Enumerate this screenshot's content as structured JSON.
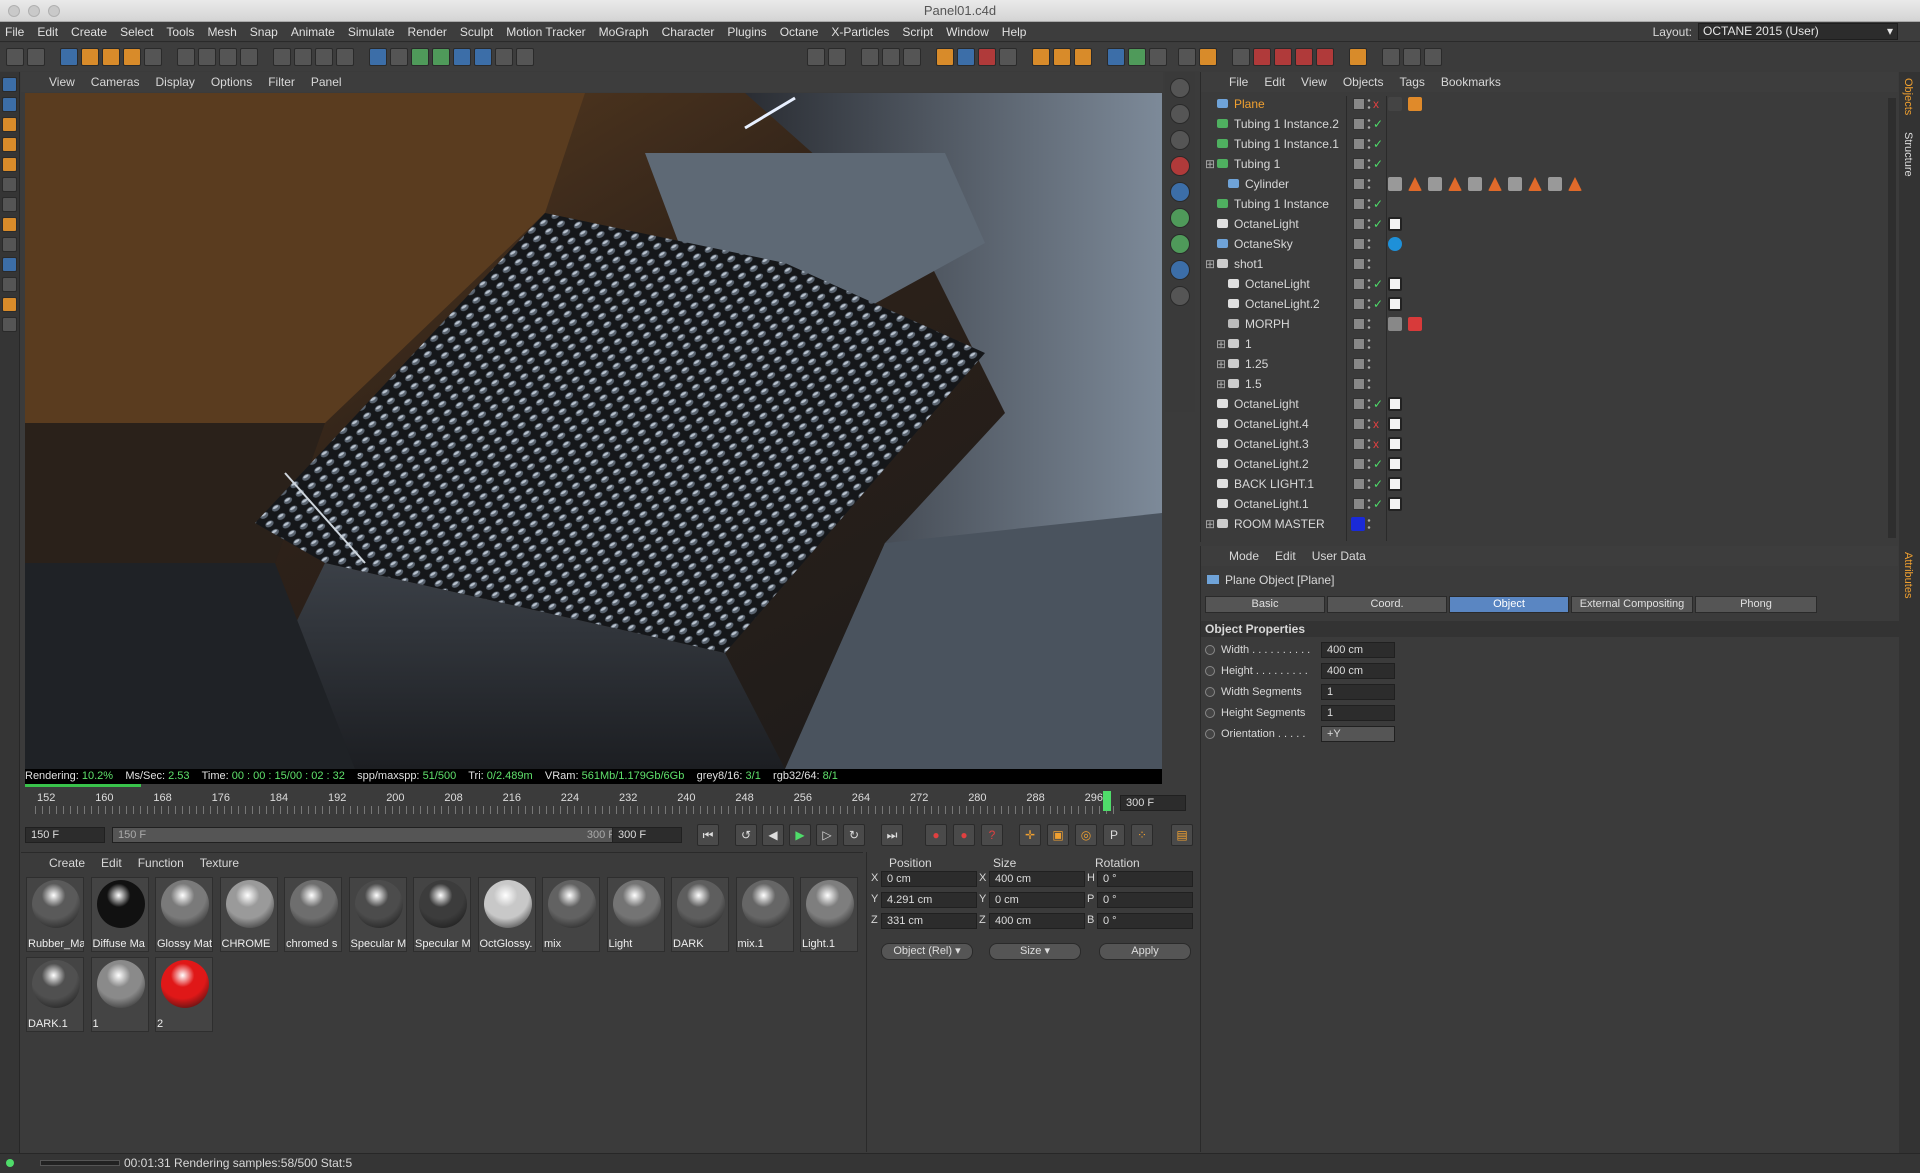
{
  "window": {
    "title": "Panel01.c4d"
  },
  "menu": [
    "File",
    "Edit",
    "Create",
    "Select",
    "Tools",
    "Mesh",
    "Snap",
    "Animate",
    "Simulate",
    "Render",
    "Sculpt",
    "Motion Tracker",
    "MoGraph",
    "Character",
    "Plugins",
    "Octane",
    "X-Particles",
    "Script",
    "Window",
    "Help"
  ],
  "layout": {
    "label": "Layout:",
    "value": "OCTANE 2015 (User)"
  },
  "viewport": {
    "menu": [
      "View",
      "Cameras",
      "Display",
      "Options",
      "Filter",
      "Panel"
    ]
  },
  "render_status": {
    "rendering_label": "Rendering:",
    "rendering": "10.2%",
    "ms_label": "Ms/Sec:",
    "ms": "2.53",
    "time_label": "Time:",
    "time": "00 : 00 : 15/00 : 02 : 32",
    "spp_label": "spp/maxspp:",
    "spp": "51/500",
    "tri_label": "Tri:",
    "tri": "0/2.489m",
    "vram_label": "VRam:",
    "vram": "561Mb/1.179Gb/6Gb",
    "grey_label": "grey8/16:",
    "grey": "3/1",
    "rgb_label": "rgb32/64:",
    "rgb": "8/1",
    "progress": 0.102
  },
  "timeline": {
    "ticks": [
      "152",
      "160",
      "168",
      "176",
      "184",
      "192",
      "200",
      "208",
      "216",
      "224",
      "232",
      "240",
      "248",
      "256",
      "264",
      "272",
      "280",
      "288",
      "296"
    ],
    "end_field": "300 F",
    "current": "150 F",
    "range_start": "150 F",
    "range_end": "300 F",
    "max": "300 F"
  },
  "materials": {
    "menu": [
      "Create",
      "Edit",
      "Function",
      "Texture"
    ],
    "items": [
      {
        "label": "Rubber_Ma",
        "color": "#5a5a5a"
      },
      {
        "label": "Diffuse Ma",
        "color": "#111111"
      },
      {
        "label": "Glossy Mat",
        "color": "#7a7a7a"
      },
      {
        "label": "CHROME",
        "color": "#9a9a9a"
      },
      {
        "label": "chromed s",
        "color": "#6e6e6e"
      },
      {
        "label": "Specular M",
        "color": "#4c4c4c"
      },
      {
        "label": "Specular M",
        "color": "#3c3c3c"
      },
      {
        "label": "OctGlossy.",
        "color": "#c8c8c8"
      },
      {
        "label": "mix",
        "color": "#626262"
      },
      {
        "label": "Light",
        "color": "#747474"
      },
      {
        "label": "DARK",
        "color": "#5e5e5e"
      },
      {
        "label": "mix.1",
        "color": "#666666"
      },
      {
        "label": "Light.1",
        "color": "#7e7e7e"
      },
      {
        "label": "DARK.1",
        "color": "#505050"
      },
      {
        "label": "1",
        "color": "#8a8a8a"
      },
      {
        "label": "2",
        "color": "#e01818"
      }
    ]
  },
  "coords": {
    "headers": [
      "Position",
      "Size",
      "Rotation"
    ],
    "rows": [
      {
        "axis": "X",
        "pos": "0 cm",
        "saxis": "X",
        "size": "400 cm",
        "raxis": "H",
        "rot": "0 °"
      },
      {
        "axis": "Y",
        "pos": "4.291 cm",
        "saxis": "Y",
        "size": "0 cm",
        "raxis": "P",
        "rot": "0 °"
      },
      {
        "axis": "Z",
        "pos": "331 cm",
        "saxis": "Z",
        "size": "400 cm",
        "raxis": "B",
        "rot": "0 °"
      }
    ],
    "mode": "Object (Rel)",
    "size_mode": "Size",
    "apply": "Apply"
  },
  "status": {
    "text": "00:01:31 Rendering samples:58/500 Stat:5"
  },
  "objects": {
    "menu": [
      "File",
      "Edit",
      "View",
      "Objects",
      "Tags",
      "Bookmarks"
    ],
    "rows": [
      {
        "name": "Plane",
        "indent": 0,
        "type": "plane",
        "check": "x",
        "selected": true
      },
      {
        "name": "Tubing 1 Instance.2",
        "indent": 0,
        "type": "tube",
        "check": "✓"
      },
      {
        "name": "Tubing 1 Instance.1",
        "indent": 0,
        "type": "tube",
        "check": "✓"
      },
      {
        "name": "Tubing 1",
        "indent": 0,
        "type": "tube",
        "check": "✓"
      },
      {
        "name": "Cylinder",
        "indent": 1,
        "type": "cyl",
        "check": ""
      },
      {
        "name": "Tubing 1 Instance",
        "indent": 0,
        "type": "tube",
        "check": "✓"
      },
      {
        "name": "OctaneLight",
        "indent": 0,
        "type": "light",
        "check": "✓"
      },
      {
        "name": "OctaneSky",
        "indent": 0,
        "type": "sky",
        "check": ""
      },
      {
        "name": "shot1",
        "indent": 0,
        "type": "null",
        "check": ""
      },
      {
        "name": "OctaneLight",
        "indent": 1,
        "type": "light",
        "check": "✓"
      },
      {
        "name": "OctaneLight.2",
        "indent": 1,
        "type": "light",
        "check": "✓"
      },
      {
        "name": "MORPH",
        "indent": 1,
        "type": "cam",
        "check": ""
      },
      {
        "name": "1",
        "indent": 1,
        "type": "null",
        "check": ""
      },
      {
        "name": "1.25",
        "indent": 1,
        "type": "null",
        "check": ""
      },
      {
        "name": "1.5",
        "indent": 1,
        "type": "null",
        "check": ""
      },
      {
        "name": "OctaneLight",
        "indent": 0,
        "type": "light",
        "check": "✓"
      },
      {
        "name": "OctaneLight.4",
        "indent": 0,
        "type": "light",
        "check": "x"
      },
      {
        "name": "OctaneLight.3",
        "indent": 0,
        "type": "light",
        "check": "x"
      },
      {
        "name": "OctaneLight.2",
        "indent": 0,
        "type": "light",
        "check": "✓"
      },
      {
        "name": "BACK LIGHT.1",
        "indent": 0,
        "type": "light",
        "check": "✓"
      },
      {
        "name": "OctaneLight.1",
        "indent": 0,
        "type": "light",
        "check": "✓"
      },
      {
        "name": "ROOM MASTER",
        "indent": 0,
        "type": "null",
        "check": ""
      }
    ]
  },
  "attributes": {
    "menu": [
      "Mode",
      "Edit",
      "User Data"
    ],
    "object_title": "Plane Object [Plane]",
    "tabs": [
      "Basic",
      "Coord.",
      "Object",
      "External Compositing",
      "Phong"
    ],
    "active_tab": "Object",
    "section": "Object Properties",
    "props": [
      {
        "label": "Width . . . . . . . . . .",
        "value": "400 cm"
      },
      {
        "label": "Height . . . . . . . . .",
        "value": "400 cm"
      },
      {
        "label": "Width Segments",
        "value": "1"
      },
      {
        "label": "Height Segments",
        "value": "1"
      },
      {
        "label": "Orientation . . . . .",
        "value": "+Y"
      }
    ]
  },
  "side_tabs": [
    "Objects",
    "Structure",
    "Attributes"
  ],
  "colors": {
    "accent": "#5a86c2",
    "render_green": "#5fe06b",
    "selected_text": "#f0a030"
  }
}
